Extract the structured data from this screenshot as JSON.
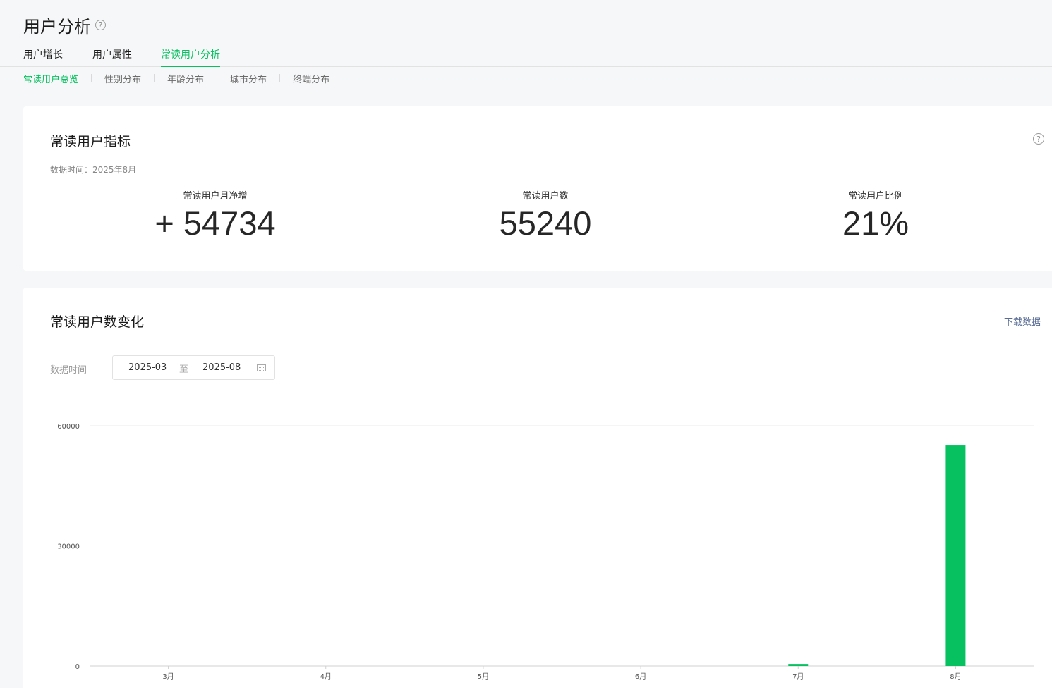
{
  "page": {
    "title": "用户分析",
    "main_tabs": [
      "用户增长",
      "用户属性",
      "常读用户分析"
    ],
    "active_main_tab": 2,
    "sub_tabs": [
      "常读用户总览",
      "性别分布",
      "年龄分布",
      "城市分布",
      "终端分布"
    ],
    "active_sub_tab": 0
  },
  "indicators": {
    "title": "常读用户指标",
    "data_time": "数据时间：2025年8月",
    "metrics": [
      {
        "label": "常读用户月净增",
        "value": "+ 54734"
      },
      {
        "label": "常读用户数",
        "value": "55240"
      },
      {
        "label": "常读用户比例",
        "value": "21%"
      }
    ]
  },
  "trend": {
    "title": "常读用户数变化",
    "download": "下载数据",
    "time_label": "数据时间",
    "date_start": "2025-03",
    "date_sep": "至",
    "date_end": "2025-08"
  },
  "icons": {
    "help": "question-circle-icon",
    "calendar": "calendar-icon"
  },
  "colors": {
    "accent": "#07c160",
    "link": "#576b95"
  },
  "chart_data": {
    "type": "bar",
    "categories": [
      "3月",
      "4月",
      "5月",
      "6月",
      "7月",
      "8月"
    ],
    "values": [
      0,
      0,
      0,
      0,
      506,
      55240
    ],
    "yticks": [
      0,
      30000,
      60000
    ],
    "ylim": [
      0,
      60000
    ],
    "title": "",
    "xlabel": "",
    "ylabel": "",
    "grid": true,
    "color": "#07c160"
  }
}
